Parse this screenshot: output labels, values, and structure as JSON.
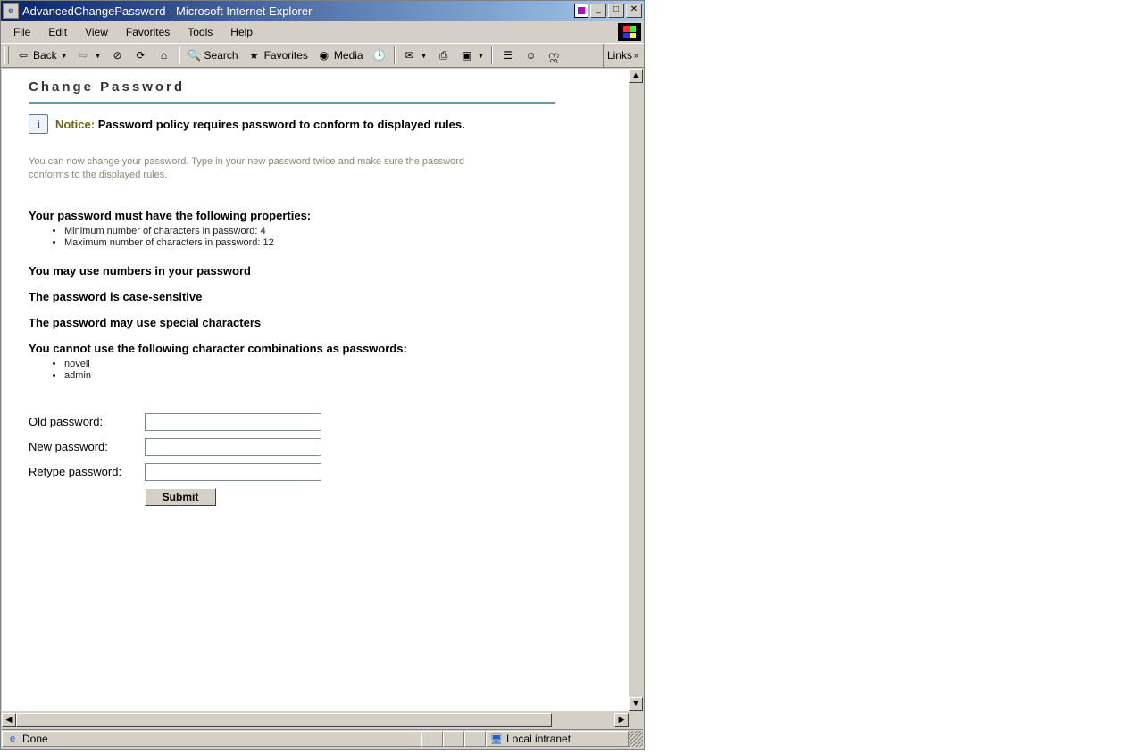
{
  "window": {
    "title": "AdvancedChangePassword - Microsoft Internet Explorer"
  },
  "menubar": {
    "file": "File",
    "edit": "Edit",
    "view": "View",
    "favorites": "Favorites",
    "tools": "Tools",
    "help": "Help"
  },
  "toolbar": {
    "back": "Back",
    "search": "Search",
    "favorites": "Favorites",
    "media": "Media",
    "links": "Links"
  },
  "page": {
    "title": "Change Password",
    "notice_label": "Notice:",
    "notice_text": "Password policy requires password to conform to displayed rules.",
    "intro": "You can now change your password. Type in your new password twice and make sure the password conforms to the displayed rules.",
    "properties_heading": "Your password must have the following properties:",
    "properties": [
      "Minimum number of characters in password: 4",
      "Maximum number of characters in password: 12"
    ],
    "rule_numbers": "You may use numbers in your password",
    "rule_case": "The password is case-sensitive",
    "rule_special": "The password may use special characters",
    "forbidden_heading": "You cannot use the following character combinations as passwords:",
    "forbidden": [
      "novell",
      "admin"
    ],
    "form": {
      "old": "Old password:",
      "new": "New password:",
      "retype": "Retype password:",
      "submit": "Submit"
    }
  },
  "statusbar": {
    "done": "Done",
    "zone": "Local intranet"
  }
}
